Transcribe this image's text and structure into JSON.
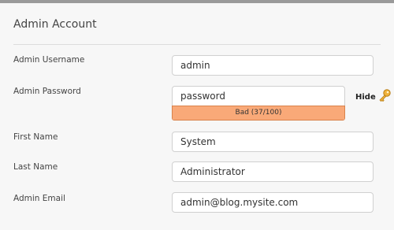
{
  "section": {
    "title": "Admin Account"
  },
  "fields": {
    "username": {
      "label": "Admin Username",
      "value": "admin"
    },
    "password": {
      "label": "Admin Password",
      "value": "password",
      "strength_text": "Bad (37/100)",
      "strength_score": 37,
      "strength_max": 100,
      "strength_color": "#f9a978",
      "toggle_label": "Hide",
      "toggle_icon": "key-icon"
    },
    "first_name": {
      "label": "First Name",
      "value": "System"
    },
    "last_name": {
      "label": "Last Name",
      "value": "Administrator"
    },
    "email": {
      "label": "Admin Email",
      "value": "admin@blog.mysite.com"
    }
  }
}
